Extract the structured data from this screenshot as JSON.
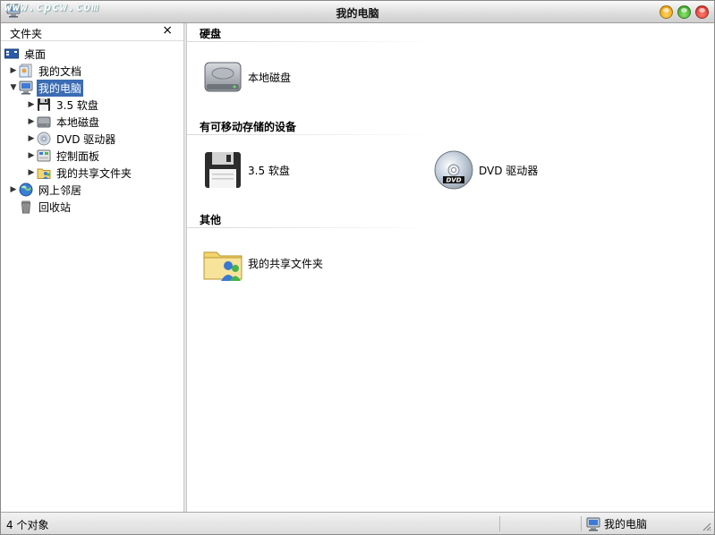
{
  "window": {
    "title": "我的电脑",
    "watermark": "www.cpcw.com",
    "icon": "computer-icon",
    "buttons": [
      "minimize",
      "maximize",
      "close"
    ]
  },
  "sidebar": {
    "title": "文件夹",
    "close_label": "×",
    "items": [
      {
        "label": "桌面",
        "icon": "desktop-icon",
        "expanded": true,
        "selected": false
      },
      {
        "label": "我的文档",
        "icon": "documents-icon",
        "expanded": false,
        "selected": false
      },
      {
        "label": "我的电脑",
        "icon": "computer-icon",
        "expanded": true,
        "selected": true
      },
      {
        "label": "3.5 软盘",
        "icon": "floppy-icon",
        "expanded": false,
        "selected": false
      },
      {
        "label": "本地磁盘",
        "icon": "hard-disk-icon",
        "expanded": false,
        "selected": false
      },
      {
        "label": "DVD 驱动器",
        "icon": "dvd-icon",
        "expanded": false,
        "selected": false
      },
      {
        "label": "控制面板",
        "icon": "control-panel-icon",
        "expanded": false,
        "selected": false
      },
      {
        "label": "我的共享文件夹",
        "icon": "shared-folder-icon",
        "expanded": false,
        "selected": false
      },
      {
        "label": "网上邻居",
        "icon": "network-icon",
        "expanded": false,
        "selected": false
      },
      {
        "label": "回收站",
        "icon": "recycle-bin-icon",
        "expanded": false,
        "selected": false
      }
    ]
  },
  "content": {
    "groups": [
      {
        "title": "硬盘",
        "items": [
          {
            "label": "本地磁盘",
            "icon": "hard-disk-icon"
          }
        ]
      },
      {
        "title": "有可移动存储的设备",
        "items": [
          {
            "label": "3.5 软盘",
            "icon": "floppy-icon"
          },
          {
            "label": "DVD 驱动器",
            "icon": "dvd-icon"
          }
        ]
      },
      {
        "title": "其他",
        "items": [
          {
            "label": "我的共享文件夹",
            "icon": "shared-folder-icon"
          }
        ]
      }
    ]
  },
  "status": {
    "count": "4 个对象",
    "location": "我的电脑",
    "location_icon": "computer-icon"
  },
  "colors": {
    "selection": "#3b6cb4",
    "minimize": "#f0a500",
    "maximize": "#3ca82a",
    "close": "#d9362a"
  }
}
